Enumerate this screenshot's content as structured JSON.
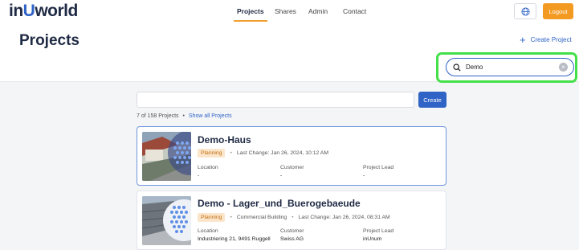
{
  "logo": {
    "part1": "in",
    "part2": "U",
    "part3": "world"
  },
  "nav": [
    {
      "label": "Projects",
      "active": true
    },
    {
      "label": "Shares",
      "active": false
    },
    {
      "label": "Admin",
      "active": false
    },
    {
      "label": "Contact",
      "active": false
    }
  ],
  "header": {
    "logout_label": "Logout",
    "language_icon": "globe-icon"
  },
  "page": {
    "title": "Projects",
    "create_project_label": "Create Project"
  },
  "search": {
    "value": "Demo"
  },
  "filter": {
    "value": "",
    "create_label": "Create"
  },
  "results": {
    "count_text": "7 of 158 Projects",
    "separator": "•",
    "show_all_label": "Show all Projects"
  },
  "projects": [
    {
      "title": "Demo-Haus",
      "status": "Planning",
      "building_type": "",
      "last_change": "Last Change: Jan 26, 2024, 10:12 AM",
      "location_label": "Location",
      "location": "-",
      "customer_label": "Customer",
      "customer": "-",
      "lead_label": "Project Lead",
      "lead": "-"
    },
    {
      "title": "Demo - Lager_und_Buerogebaeude",
      "status": "Planning",
      "building_type": "Commercial Building",
      "last_change": "Last Change: Jan 26, 2024, 08:31 AM",
      "location_label": "Location",
      "location": "Industriering 21, 9491 Ruggell",
      "customer_label": "Customer",
      "customer": "Swiss AG",
      "lead_label": "Project Lead",
      "lead": "inUnum"
    }
  ],
  "colors": {
    "accent": "#2f63c6",
    "logout": "#f39a22",
    "badge_bg": "#fbe6cc",
    "badge_text": "#c46d10",
    "highlight": "#44e04a"
  }
}
